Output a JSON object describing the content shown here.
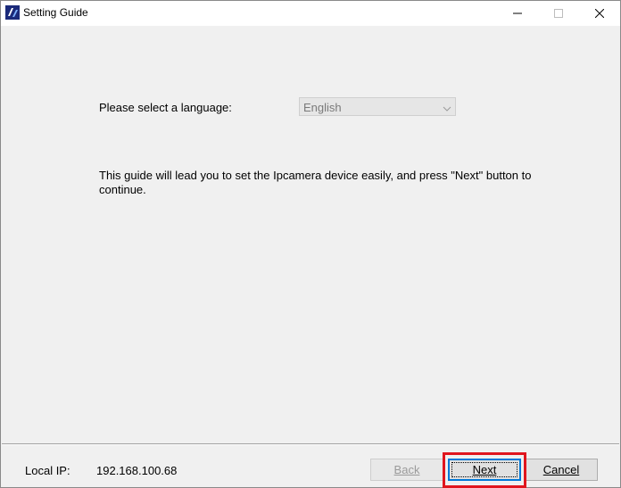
{
  "window": {
    "title": "Setting Guide"
  },
  "language": {
    "label": "Please select a language:",
    "selected": "English"
  },
  "guide": {
    "text": "This guide will lead you to set the Ipcamera device easily, and press \"Next\" button to continue."
  },
  "footer": {
    "local_ip_label": "Local IP:",
    "local_ip_value": "192.168.100.68",
    "back_label": "Back",
    "next_label": "Next",
    "cancel_label": "Cancel"
  },
  "colors": {
    "highlight": "#e0161e",
    "focus_blue": "#0078d7",
    "window_bg": "#f0f0f0"
  },
  "icons": {
    "app": "app-icon",
    "minimize": "minimize-icon",
    "maximize": "maximize-icon",
    "close": "close-icon",
    "dropdown": "chevron-down-icon"
  }
}
